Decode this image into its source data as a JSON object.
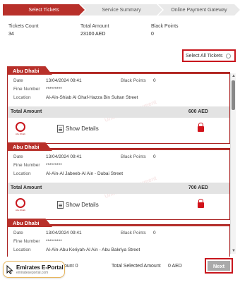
{
  "steps": [
    "Select Tickets",
    "Service Summary",
    "Online Payment Gateway"
  ],
  "summary": {
    "tickets_count_label": "Tickets Count",
    "tickets_count": "34",
    "total_amount_label": "Total Amount",
    "total_amount": "23100 AED",
    "black_points_label": "Black Points",
    "black_points": "0"
  },
  "select_all_label": "Select All Tickets",
  "labels": {
    "date": "Date",
    "fine_number": "Fine Number",
    "location": "Location",
    "black_points": "Black Points",
    "total_amount": "Total Amount",
    "show_details": "Show Details",
    "watermark": "Unofficial Document"
  },
  "tickets": [
    {
      "emirate": "Abu Dhabi",
      "date": "13/04/2024 09:41",
      "fine_number": "*********",
      "black_points": "0",
      "location": "Al-Ain-Shiab Al Ghaf-Hazza Bin Sultan Street",
      "amount": "600 AED"
    },
    {
      "emirate": "Abu Dhabi",
      "date": "13/04/2024 09:41",
      "fine_number": "*********",
      "black_points": "0",
      "location": "Al-Ain-Al Jabeeb-Al Ain - Dubai Street",
      "amount": "700 AED"
    },
    {
      "emirate": "Abu Dhabi",
      "date": "13/04/2024 09:41",
      "fine_number": "*********",
      "black_points": "0",
      "location": "Al-Ain-Abu Keriyah-Al Ain - Abu Bakriya Street",
      "amount": ""
    }
  ],
  "footer": {
    "total_selected_count_label": "Total Selected Count",
    "total_selected_count": "0",
    "total_selected_amount_label": "Total Selected Amount",
    "total_selected_amount": "0 AED",
    "next_label": "Next"
  },
  "brand": {
    "name": "Emirates E-Portal",
    "url": "emirateseportal.com"
  },
  "colors": {
    "accent": "#b8302a",
    "highlight_border": "#c8161d",
    "lock": "#d1121a"
  }
}
